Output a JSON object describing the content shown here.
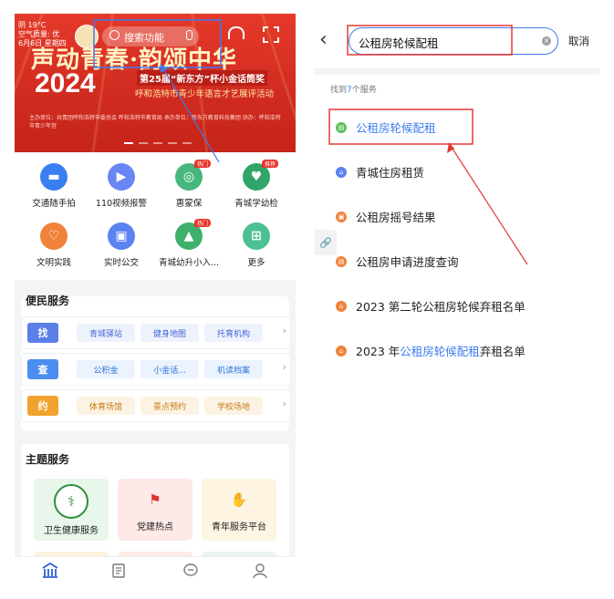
{
  "left": {
    "banner": {
      "weather": [
        "阴 19°C",
        "空气质量: 优",
        "6月6日 星期四"
      ],
      "search_placeholder": "搜索功能",
      "title": "声动青春·韵颂中华",
      "year": "2024",
      "subtitle_1": "第25届“新东方”杯小金话筒奖",
      "subtitle_2": "呼和浩特市青少年语言才艺展评活动",
      "fine_print": "主办单位：共青团呼和浩特市委员会 呼和浩特市教育局 承办单位：新东方教育科技集团 协办：呼和浩特市青少年宫"
    },
    "grid": [
      {
        "label": "交通随手拍",
        "icon": "car-icon",
        "color": "#3a7ff2",
        "badge": ""
      },
      {
        "label": "110视频报警",
        "icon": "video-alarm-icon",
        "color": "#6a86f4",
        "badge": ""
      },
      {
        "label": "惠蒙保",
        "icon": "insurance-icon",
        "color": "#48b77d",
        "badge": "热门"
      },
      {
        "label": "青城学幼检",
        "icon": "shield-icon",
        "color": "#2fa56a",
        "badge": "推荐"
      },
      {
        "label": "文明实践",
        "icon": "heart-icon",
        "color": "#f0823b",
        "badge": ""
      },
      {
        "label": "实时公交",
        "icon": "bus-icon",
        "color": "#5b82f1",
        "badge": ""
      },
      {
        "label": "青城幼升小入...",
        "icon": "graduation-icon",
        "color": "#3fb06c",
        "badge": "热门"
      },
      {
        "label": "更多",
        "icon": "more-grid-icon",
        "color": "#4cc093",
        "badge": ""
      }
    ],
    "convenience": {
      "title": "便民服务",
      "rows": [
        {
          "tag": "找",
          "tag_color": "#5b7fe8",
          "chip_bg": "#eef2fd",
          "chip_color": "#4266d4",
          "items": [
            "青城驿站",
            "健身地图",
            "托育机构"
          ]
        },
        {
          "tag": "查",
          "tag_color": "#4c8ef0",
          "chip_bg": "#eaf3fe",
          "chip_color": "#3373d8",
          "items": [
            "公积金",
            "小金话...",
            "机读档案"
          ]
        },
        {
          "tag": "约",
          "tag_color": "#f0a32e",
          "chip_bg": "#fdf3e4",
          "chip_color": "#c47a12",
          "items": [
            "体育场馆",
            "景点预约",
            "学校场地"
          ]
        }
      ]
    },
    "theme": {
      "title": "主题服务",
      "cards": [
        {
          "label": "卫生健康服务",
          "icon": "health-logo-icon",
          "bg": "#e9f6ea",
          "icon_color": "#2f8f3c"
        },
        {
          "label": "党建热点",
          "icon": "party-flag-icon",
          "bg": "#fde9e7",
          "icon_color": "#d9362b"
        },
        {
          "label": "青年服务平台",
          "icon": "youth-hands-icon",
          "bg": "#fdf5e2",
          "icon_color": "#e0a12a"
        }
      ]
    },
    "tabbar": [
      "home-icon",
      "news-icon",
      "chat-icon",
      "profile-icon"
    ]
  },
  "right": {
    "search_value": "公租房轮候配租",
    "cancel_label": "取消",
    "found_prefix": "找到",
    "found_count": "7",
    "found_suffix": "个服务",
    "results": [
      {
        "parts": [
          {
            "t": "公租房轮候配租",
            "hl": true
          }
        ],
        "icon_color": "#5cbf5c",
        "icon": "document-icon"
      },
      {
        "parts": [
          {
            "t": "青城住房租赁",
            "hl": false
          }
        ],
        "icon_color": "#5b82f1",
        "icon": "house-icon"
      },
      {
        "parts": [
          {
            "t": "公租房摇号结果",
            "hl": false
          }
        ],
        "icon_color": "#f0823b",
        "icon": "lottery-icon"
      },
      {
        "parts": [
          {
            "t": "公租房申请进度查询",
            "hl": false
          }
        ],
        "icon_color": "#f0823b",
        "icon": "progress-icon"
      },
      {
        "parts": [
          {
            "t": "2023 第二轮公租房轮候弃租名单",
            "hl": false
          }
        ],
        "icon_color": "#f0823b",
        "icon": "list-icon"
      },
      {
        "parts": [
          {
            "t": "2023 年",
            "hl": false
          },
          {
            "t": "公租房轮候配租",
            "hl": true
          },
          {
            "t": "弃租名单",
            "hl": false
          }
        ],
        "icon_color": "#f0823b",
        "icon": "list-icon"
      }
    ]
  },
  "colors": {
    "accent": "#3b7bf0",
    "annotation": "#e53935",
    "banner_red": "#d22c21"
  }
}
